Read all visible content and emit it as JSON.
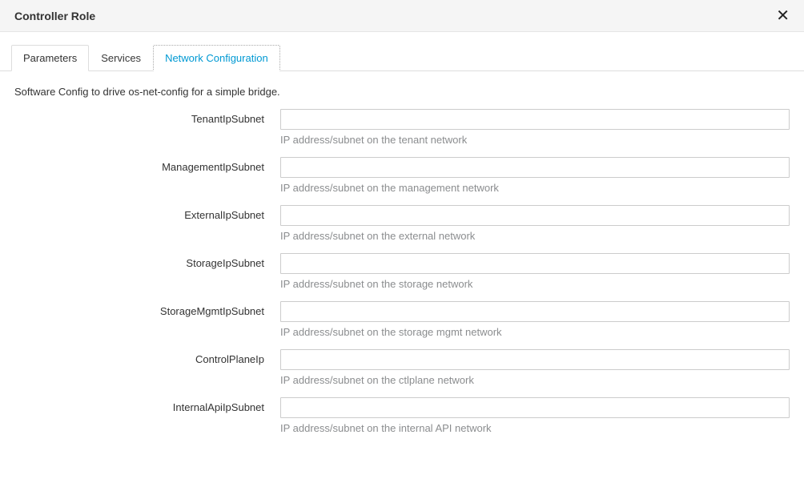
{
  "header": {
    "title": "Controller Role"
  },
  "tabs": [
    {
      "label": "Parameters"
    },
    {
      "label": "Services"
    },
    {
      "label": "Network Configuration"
    }
  ],
  "description": "Software Config to drive os-net-config for a simple bridge.",
  "fields": [
    {
      "label": "TenantIpSubnet",
      "help": "IP address/subnet on the tenant network"
    },
    {
      "label": "ManagementIpSubnet",
      "help": "IP address/subnet on the management network"
    },
    {
      "label": "ExternalIpSubnet",
      "help": "IP address/subnet on the external network"
    },
    {
      "label": "StorageIpSubnet",
      "help": "IP address/subnet on the storage network"
    },
    {
      "label": "StorageMgmtIpSubnet",
      "help": "IP address/subnet on the storage mgmt network"
    },
    {
      "label": "ControlPlaneIp",
      "help": "IP address/subnet on the ctlplane network"
    },
    {
      "label": "InternalApiIpSubnet",
      "help": "IP address/subnet on the internal API network"
    }
  ]
}
